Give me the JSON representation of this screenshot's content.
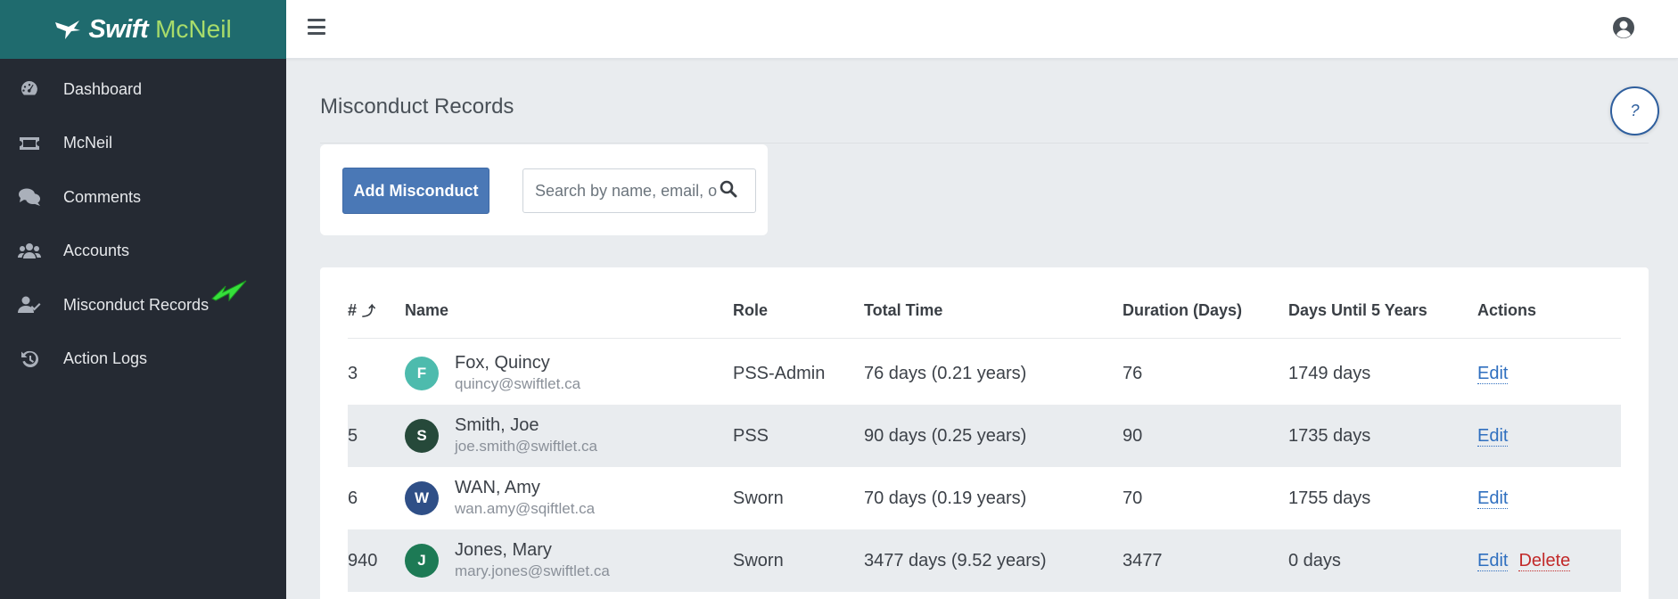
{
  "brand": {
    "name_part1": "Swift",
    "name_part2": "McNeil"
  },
  "sidebar": {
    "items": [
      {
        "label": "Dashboard",
        "icon": "dashboard-icon"
      },
      {
        "label": "McNeil",
        "icon": "ticket-icon"
      },
      {
        "label": "Comments",
        "icon": "comments-icon"
      },
      {
        "label": "Accounts",
        "icon": "users-icon"
      },
      {
        "label": "Misconduct Records",
        "icon": "user-check-icon",
        "active": true
      },
      {
        "label": "Action Logs",
        "icon": "history-icon"
      }
    ]
  },
  "page": {
    "title": "Misconduct Records",
    "help_label": "?"
  },
  "toolbar": {
    "add_label": "Add Misconduct",
    "search_placeholder": "Search by name, email, or role"
  },
  "table": {
    "columns": {
      "num": "#",
      "name": "Name",
      "role": "Role",
      "total_time": "Total Time",
      "duration": "Duration (Days)",
      "days_until": "Days Until 5 Years",
      "actions": "Actions"
    },
    "rows": [
      {
        "num": "3",
        "initial": "F",
        "avatar_color": "#4dbbad",
        "name": "Fox, Quincy",
        "email": "quincy@swiftlet.ca",
        "role": "PSS-Admin",
        "total_time": "76 days (0.21 years)",
        "duration": "76",
        "days_until": "1749 days",
        "edit": "Edit",
        "delete": ""
      },
      {
        "num": "5",
        "initial": "S",
        "avatar_color": "#26493a",
        "name": "Smith, Joe",
        "email": "joe.smith@swiftlet.ca",
        "role": "PSS",
        "total_time": "90 days (0.25 years)",
        "duration": "90",
        "days_until": "1735 days",
        "edit": "Edit",
        "delete": ""
      },
      {
        "num": "6",
        "initial": "W",
        "avatar_color": "#2f4f87",
        "name": "WAN, Amy",
        "email": "wan.amy@sqiftlet.ca",
        "role": "Sworn",
        "total_time": "70 days (0.19 years)",
        "duration": "70",
        "days_until": "1755 days",
        "edit": "Edit",
        "delete": ""
      },
      {
        "num": "940",
        "initial": "J",
        "avatar_color": "#1d7a55",
        "name": "Jones, Mary",
        "email": "mary.jones@swiftlet.ca",
        "role": "Sworn",
        "total_time": "3477 days (9.52 years)",
        "duration": "3477",
        "days_until": "0 days",
        "edit": "Edit",
        "delete": "Delete"
      }
    ]
  },
  "colors": {
    "sidebar_bg": "#252a33",
    "brand_bg": "#1f6b6e",
    "accent": "#4a78b6",
    "link": "#2f6fbf",
    "danger": "#c22a2a",
    "pointer": "#35e03a"
  }
}
